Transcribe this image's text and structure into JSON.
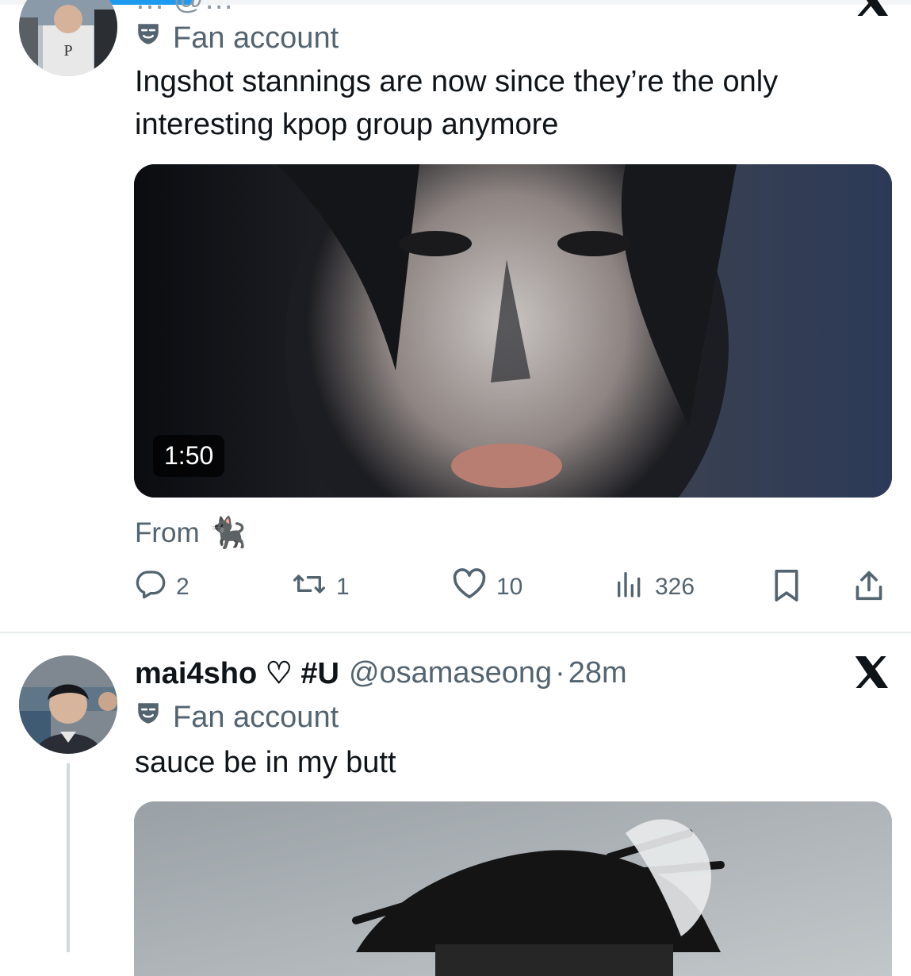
{
  "tweet1": {
    "header_partial": "… @…",
    "label": "Fan account",
    "text_line1": "Ingshot stannings are now since they’re the only",
    "text_line2": "interesting kpop group anymore",
    "video_duration": "1:50",
    "from_label": "From",
    "from_emoji": "🐈‍⬛",
    "stats": {
      "replies": "2",
      "reposts": "1",
      "likes": "10",
      "views": "326"
    }
  },
  "tweet2": {
    "display_name": "mai4sho ♡ #U",
    "handle": "@osamaseong",
    "dot": "·",
    "time": "28m",
    "label": "Fan account",
    "text": "sauce be in my butt"
  },
  "colors": {
    "text": "#0f1419",
    "muted": "#536471",
    "divider": "#e6ebee",
    "accent": "#1d9bf0"
  },
  "icons": [
    "theater-mask-icon",
    "reply-icon",
    "repost-icon",
    "like-icon",
    "views-icon",
    "bookmark-icon",
    "share-icon",
    "x-logo-icon"
  ]
}
